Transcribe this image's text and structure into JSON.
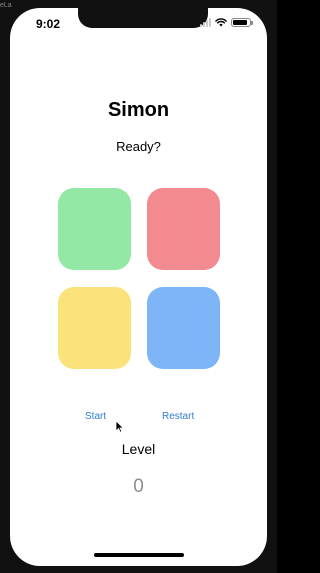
{
  "background_label": "eLa",
  "status_bar": {
    "time": "9:02",
    "battery_level": 0.9
  },
  "app": {
    "title": "Simon",
    "status": "Ready?",
    "pads": [
      {
        "name": "green",
        "color": "#93e8a6"
      },
      {
        "name": "red",
        "color": "#f28a8f"
      },
      {
        "name": "yellow",
        "color": "#fbe37b"
      },
      {
        "name": "blue",
        "color": "#7db5f7"
      }
    ],
    "buttons": {
      "start": "Start",
      "restart": "Restart"
    },
    "level": {
      "label": "Level",
      "value": "0"
    }
  },
  "colors": {
    "accent": "#2f7fd0",
    "level_value": "#8e8e8e"
  }
}
